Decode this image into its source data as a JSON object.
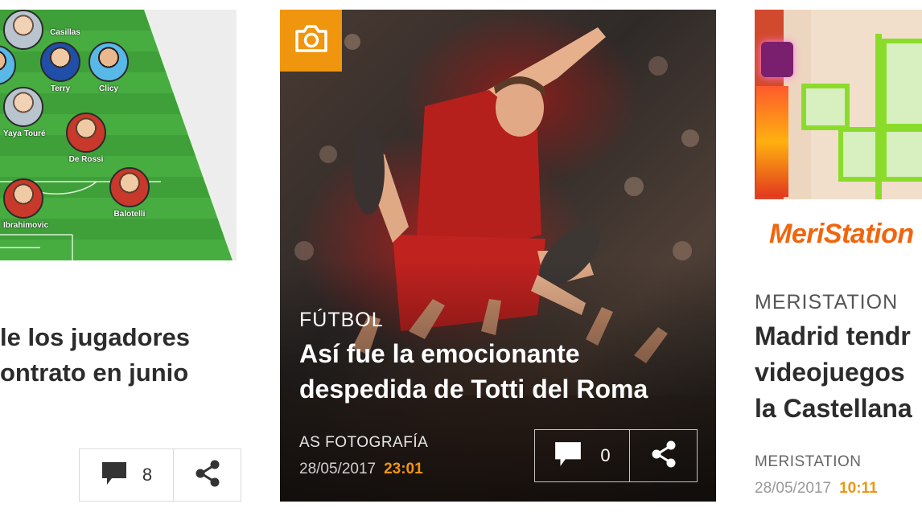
{
  "left_card": {
    "title_line1": "le los jugadores",
    "title_line2": "ontrato en junio",
    "comments_count": "8",
    "players": [
      "Casillas",
      "Terry",
      "Clicy",
      "Yaya Touré",
      "De Rossi",
      "Balotelli",
      "Ibrahimovic"
    ]
  },
  "center_card": {
    "badge_icon": "camera-icon",
    "section": "FÚTBOL",
    "title": "Así fue la emocionante despedida de Totti del Roma",
    "author": "AS FOTOGRAFÍA",
    "date": "28/05/2017",
    "time": "23:01",
    "comments_count": "0"
  },
  "right_card": {
    "logo": "MeriStation",
    "section": "MERISTATION",
    "title_line1": "Madrid tendr",
    "title_line2": "videojuegos",
    "title_line3": "la Castellana",
    "author": "MERISTATION",
    "date": "28/05/2017",
    "time": "10:11"
  },
  "colors": {
    "accent": "#f0950e",
    "logo": "#f0650e",
    "pitch": "#47ad41",
    "text_dark": "#2c2c2c"
  }
}
